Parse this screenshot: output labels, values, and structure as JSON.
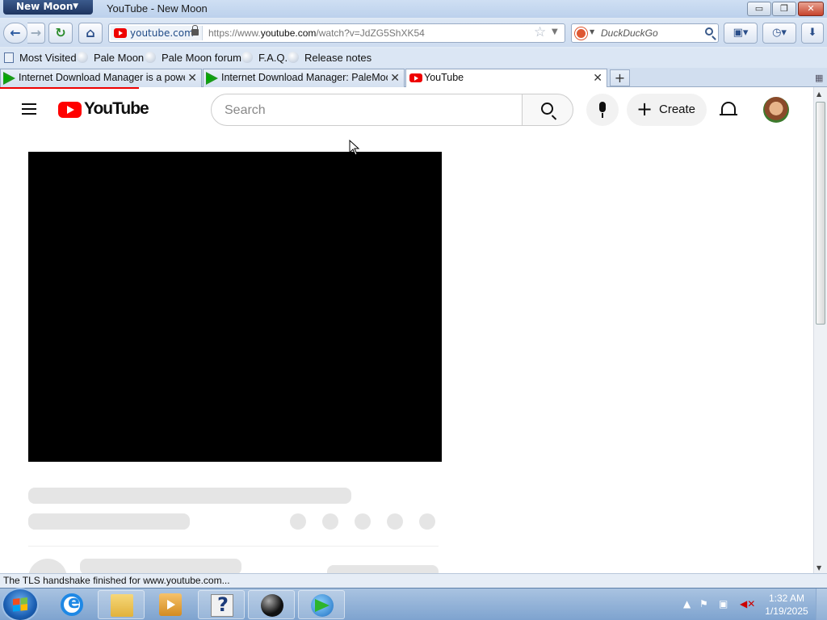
{
  "window": {
    "app_menu": "New Moon",
    "title": "YouTube - New Moon",
    "minimize": "▭",
    "restore": "❐",
    "close": "✕"
  },
  "navbar": {
    "identity": "youtube.com",
    "url_prefix": "https://www.",
    "url_domain": "youtube.com",
    "url_path": "/watch?v=JdZG5ShXK54",
    "search_placeholder": "DuckDuckGo"
  },
  "bookmarks": [
    {
      "label": "Most Visited",
      "icon": "most-visited-icon"
    },
    {
      "label": "Pale Moon",
      "icon": "globe-icon"
    },
    {
      "label": "Pale Moon forum",
      "icon": "globe-icon"
    },
    {
      "label": "F.A.Q.",
      "icon": "globe-icon"
    },
    {
      "label": "Release notes",
      "icon": "globe-icon"
    }
  ],
  "tabs": [
    {
      "label": "Internet Download Manager is a power",
      "icon": "idm-icon",
      "active": false
    },
    {
      "label": "Internet Download Manager: PaleMoon",
      "icon": "idm-icon",
      "active": false
    },
    {
      "label": "YouTube",
      "icon": "youtube-icon",
      "active": true
    }
  ],
  "page": {
    "logo": "YouTube",
    "search_placeholder": "Search",
    "create_label": "Create"
  },
  "status": "The TLS handshake finished for www.youtube.com...",
  "taskbar": {
    "time": "1:32 AM",
    "date": "1/19/2025"
  },
  "colors": {
    "youtube_red": "#ff0000",
    "titlebar": "#cfdff3"
  }
}
